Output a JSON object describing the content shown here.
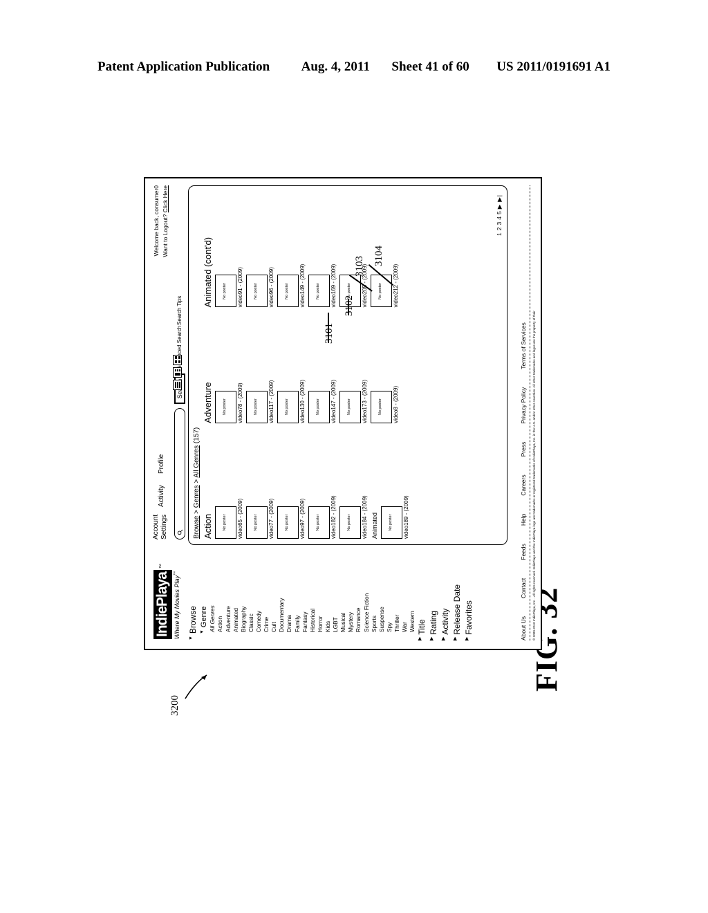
{
  "patent_header": {
    "publication": "Patent Application Publication",
    "date": "Aug. 4, 2011",
    "sheet": "Sheet 41 of 60",
    "number": "US 2011/0191691 A1"
  },
  "figure": {
    "label": "FIG. 32",
    "ref_main": "3200",
    "callouts": [
      "3101",
      "3102",
      "3103",
      "3104"
    ]
  },
  "app": {
    "logo_text": "IndiePlaya",
    "logo_tm": "™",
    "tagline": "Where My Movies Play",
    "tagline_tm": "™"
  },
  "welcome": {
    "line1": "Welcome back, consumer0",
    "line2_prefix": "Want to Logout? ",
    "line2_link": "Click Here"
  },
  "topnav": {
    "account": "Account",
    "settings": "Settings",
    "activity": "Activity",
    "profile": "Profile"
  },
  "search": {
    "placeholder": "",
    "value": "",
    "button_label": "Search",
    "advanced": "Advanced Search",
    "tips": "Search Tips",
    "icon": "search-icon"
  },
  "view_toggle": {
    "options": [
      "list-view-icon",
      "grid-view-icon",
      "detail-view-icon"
    ],
    "selected": "list-view-icon"
  },
  "sidebar": {
    "browse_label": "Browse",
    "genre_label": "Genre",
    "genres": [
      "All Genres",
      "Action",
      "Adventure",
      "Animated",
      "Biography",
      "Classic",
      "Comedy",
      "Crime",
      "Cult",
      "Documentary",
      "Drama",
      "Family",
      "Fantasy",
      "Historical",
      "Horror",
      "Kids",
      "LGBT",
      "Musical",
      "Mystery",
      "Romance",
      "Science Fiction",
      "Sports",
      "Suspense",
      "Spy",
      "Thriller",
      "War",
      "Western"
    ],
    "sections": [
      "Title",
      "Rating",
      "Activity",
      "Release Date",
      "Favorites"
    ]
  },
  "breadcrumb": {
    "b1": "Browse",
    "sep1": " > ",
    "b2": "Genres",
    "sep2": " > ",
    "b3": "All Genres",
    "count": " (157)"
  },
  "columns": [
    {
      "heading": "Action",
      "sub_heading": "Animated",
      "videos": [
        {
          "title": "video65 - (2009)",
          "poster": "No poster"
        },
        {
          "title": "video77 - (2009)",
          "poster": "No poster"
        },
        {
          "title": "video97 - (2009)",
          "poster": "No poster"
        },
        {
          "title": "video182 - (2009)",
          "poster": "No poster"
        },
        {
          "title": "video184 - (2009)",
          "poster": "No poster"
        }
      ],
      "sub_videos": [
        {
          "title": "video189 - (2009)",
          "poster": "No poster"
        }
      ]
    },
    {
      "heading": "Adventure",
      "sub_heading": "",
      "videos": [
        {
          "title": "video78 - (2009)",
          "poster": "No poster"
        },
        {
          "title": "video117 - (2009)",
          "poster": "No poster"
        },
        {
          "title": "video130 - (2009)",
          "poster": "No poster"
        },
        {
          "title": "video147 - (2009)",
          "poster": "No poster"
        },
        {
          "title": "video173 - (2009)",
          "poster": "No poster"
        }
      ],
      "sub_videos": [
        {
          "title": "video8 - (2009)",
          "poster": "No poster"
        }
      ]
    },
    {
      "heading": "Animated (cont'd)",
      "sub_heading": "",
      "videos": [
        {
          "title": "video91 - (2009)",
          "poster": "No poster"
        },
        {
          "title": "video96 - (2009)",
          "poster": "No poster"
        },
        {
          "title": "video149 - (2009)",
          "poster": "No poster"
        },
        {
          "title": "video169 - (2009)",
          "poster": "No poster"
        },
        {
          "title": "video205 - (2009)",
          "poster": "No poster"
        },
        {
          "title": "video212 - (2009)",
          "poster": "No poster"
        }
      ],
      "sub_videos": []
    }
  ],
  "pagination": {
    "pages": [
      "1",
      "2",
      "3",
      "4",
      "5"
    ],
    "next": "▶",
    "last": "▶|"
  },
  "footer": {
    "links": [
      "About Us",
      "Contact",
      "Feeds",
      "Help",
      "Careers",
      "Press",
      "Privacy Policy",
      "Terms of Services"
    ],
    "copyright": "© 2009-2010 IndiePlaya, Inc. - All rights reserved.  IndiePlaya and the IndiePlaya logo are trademarks or registered trademarks of IndiePlaya, Inc. in the U.S. and/or other countries.  All other trademarks and logos are the property of their"
  }
}
